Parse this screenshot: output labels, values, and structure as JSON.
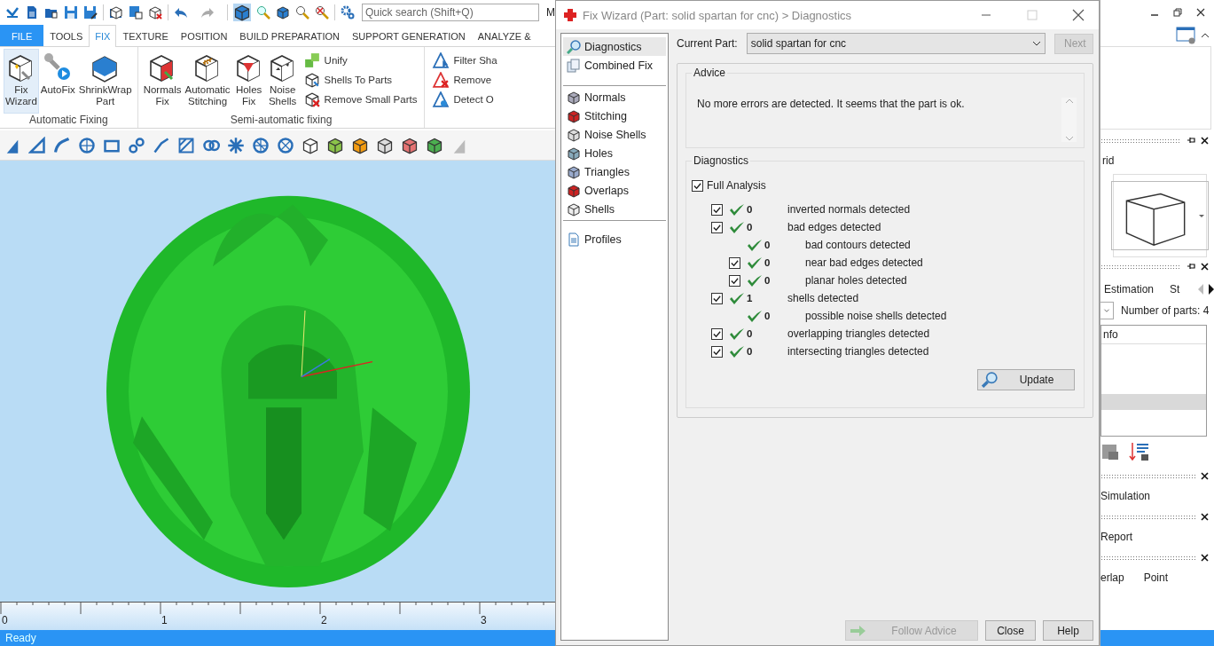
{
  "app": {
    "search": {
      "placeholder": "Quick search (Shift+Q)"
    },
    "cut_label": "M",
    "tabs": [
      {
        "label": "FILE",
        "kind": "file",
        "selected": false
      },
      {
        "label": "TOOLS",
        "kind": "tab",
        "selected": false
      },
      {
        "label": "FIX",
        "kind": "tab",
        "selected": true
      },
      {
        "label": "TEXTURE",
        "kind": "tab",
        "selected": false
      },
      {
        "label": "POSITION",
        "kind": "tab",
        "selected": false
      },
      {
        "label": "BUILD PREPARATION",
        "kind": "tab",
        "selected": false
      },
      {
        "label": "SUPPORT GENERATION",
        "kind": "tab",
        "selected": false
      },
      {
        "label": "ANALYZE &",
        "kind": "tab",
        "selected": false
      }
    ],
    "ribbon": [
      {
        "label": "Automatic Fixing",
        "large": [
          {
            "label": "Fix\nWizard",
            "selected": true
          },
          {
            "label": "AutoFix",
            "selected": false
          },
          {
            "label": "ShrinkWrap\nPart",
            "selected": false
          }
        ]
      },
      {
        "label": "Semi-automatic fixing",
        "large": [
          {
            "label": "Normals\nFix",
            "selected": false
          },
          {
            "label": "Automatic\nStitching",
            "selected": false
          },
          {
            "label": "Holes\nFix",
            "selected": false
          },
          {
            "label": "Noise\nShells",
            "selected": false
          }
        ],
        "small": [
          "Unify",
          "Shells To Parts",
          "Remove Small Parts"
        ]
      },
      {
        "small": [
          "Filter Sha",
          "Remove",
          "Detect O"
        ]
      }
    ],
    "ruler": [
      "0",
      "1",
      "2",
      "3"
    ],
    "status": "Ready"
  },
  "dialog": {
    "title": "Fix Wizard (Part: solid spartan  for cnc) > Diagnostics",
    "nav": [
      [
        {
          "label": "Diagnostics",
          "selected": true
        },
        {
          "label": "Combined Fix",
          "selected": false
        }
      ],
      [
        {
          "label": "Normals",
          "selected": false
        },
        {
          "label": "Stitching",
          "selected": false
        },
        {
          "label": "Noise Shells",
          "selected": false
        },
        {
          "label": "Holes",
          "selected": false
        },
        {
          "label": "Triangles",
          "selected": false
        },
        {
          "label": "Overlaps",
          "selected": false
        },
        {
          "label": "Shells",
          "selected": false
        }
      ],
      [
        {
          "label": "Profiles",
          "selected": false
        }
      ]
    ],
    "current_part": {
      "label": "Current Part:",
      "value": "solid spartan  for cnc"
    },
    "next": {
      "label": "Next",
      "disabled": true
    },
    "advice": {
      "title": "Advice",
      "text": "No more errors are detected. It seems that the part is ok."
    },
    "diagnostics": {
      "title": "Diagnostics",
      "full_analysis": {
        "label": "Full Analysis",
        "checked": true
      },
      "rows": [
        {
          "kind": "checkbox",
          "checked": true,
          "count": "0",
          "text": "inverted normals detected"
        },
        {
          "kind": "checkbox",
          "checked": true,
          "count": "0",
          "text": "bad edges detected",
          "children": [
            {
              "kind": "plain",
              "count": "0",
              "text": "bad contours detected"
            },
            {
              "kind": "checkbox",
              "checked": true,
              "count": "0",
              "text": "near bad edges detected"
            },
            {
              "kind": "checkbox",
              "checked": true,
              "count": "0",
              "text": "planar holes detected"
            }
          ]
        },
        {
          "kind": "checkbox",
          "checked": true,
          "count": "1",
          "text": "shells detected",
          "children": [
            {
              "kind": "plain",
              "count": "0",
              "text": "possible noise shells detected"
            }
          ]
        },
        {
          "kind": "checkbox",
          "checked": true,
          "count": "0",
          "text": "overlapping triangles detected"
        },
        {
          "kind": "checkbox",
          "checked": true,
          "count": "0",
          "text": "intersecting triangles detected"
        }
      ],
      "update": "Update"
    },
    "buttons": [
      {
        "label": "Follow Advice",
        "disabled": true
      },
      {
        "label": "Close",
        "disabled": false
      },
      {
        "label": "Help",
        "disabled": false
      }
    ]
  },
  "right_panel": {
    "panel_label": "rid",
    "tabs": [
      "Estimation",
      "St"
    ],
    "parts_count": "Number of parts: 4",
    "table_header": "nfo",
    "table_rows": [
      {
        "selected": true
      }
    ],
    "panels": [
      [
        "Simulation"
      ],
      [
        "Report"
      ],
      [
        "erlap",
        "Point"
      ]
    ]
  }
}
